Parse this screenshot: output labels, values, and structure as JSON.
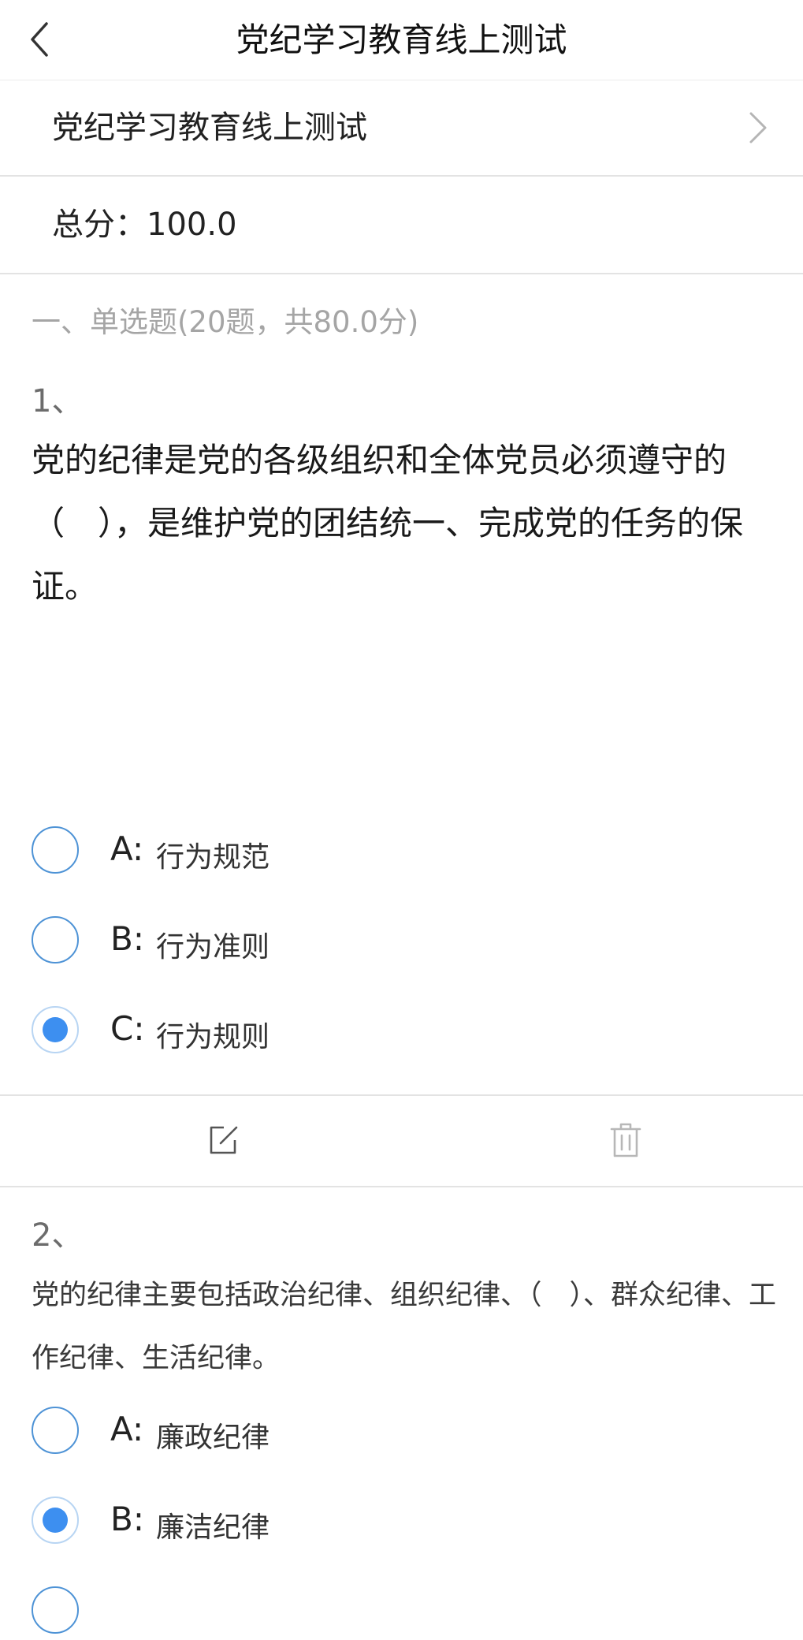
{
  "nav": {
    "title": "党纪学习教育线上测试"
  },
  "exam": {
    "name": "党纪学习教育线上测试",
    "total_score_label": "总分：",
    "total_score": "100.0"
  },
  "section": {
    "heading": "一、单选题(20题，共80.0分)"
  },
  "questions": [
    {
      "number": "1、",
      "text": "党的纪律是党的各级组织和全体党员必须遵守的（　），是维护党的团结统一、完成党的任务的保证。",
      "options": [
        {
          "letter": "A:",
          "text": "行为规范",
          "selected": false
        },
        {
          "letter": "B:",
          "text": "行为准则",
          "selected": false
        },
        {
          "letter": "C:",
          "text": "行为规则",
          "selected": true
        }
      ]
    },
    {
      "number": "2、",
      "text": "党的纪律主要包括政治纪律、组织纪律、（　）、群众纪律、工作纪律、生活纪律。",
      "options": [
        {
          "letter": "A:",
          "text": "廉政纪律",
          "selected": false
        },
        {
          "letter": "B:",
          "text": "廉洁纪律",
          "selected": true
        }
      ]
    }
  ],
  "icons": {
    "back": "chevron-left-icon",
    "row_arrow": "chevron-right-icon",
    "edit": "edit-icon",
    "delete": "trash-icon"
  },
  "colors": {
    "accent": "#3d8ff0",
    "radio_border": "#4e93d6",
    "muted_text": "#a5a5a5",
    "divider": "#e3e3e3"
  }
}
